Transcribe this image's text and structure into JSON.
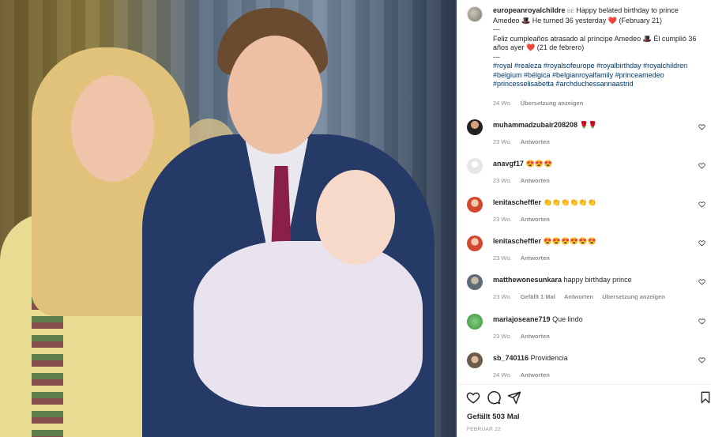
{
  "post": {
    "author": "europeanroyalchildre",
    "author_tag": "BE",
    "caption_line1": "Happy belated birthday to prince Amedeo 🎩 He turned 36 yesterday ❤️ (February 21)",
    "caption_sep1": "---",
    "caption_line2": "Feliz cumpleaños atrasado al príncipe Amedeo 🎩 Él cumplió 36 años ayer ❤️ (21 de febrero)",
    "caption_sep2": "---",
    "hashtags": "#royal #realeza #royalsofeurope #royalbirthday #royalchildren #belgium #bélgica #belgianroyalfamily #princeamedeo #princesselisabetta #archduchessannaastrid",
    "time": "24 Wo.",
    "translate": "Übersetzung anzeigen"
  },
  "comments": [
    {
      "user": "muhammadzubair208208",
      "text": "🌹🌹",
      "time": "23 Wo.",
      "reply": "Antworten"
    },
    {
      "user": "anavgf17",
      "text": "😍😍😍",
      "time": "23 Wo.",
      "reply": "Antworten"
    },
    {
      "user": "lenitascheffler",
      "text": "👏👏👏👏👏👏",
      "time": "23 Wo.",
      "reply": "Antworten"
    },
    {
      "user": "lenitascheffler",
      "text": "😍😍😍😍😍😍",
      "time": "23 Wo.",
      "reply": "Antworten"
    },
    {
      "user": "matthewonesunkara",
      "text": "happy birthday prince",
      "time": "23 Wo.",
      "likes": "Gefällt 1 Mal",
      "reply": "Antworten",
      "translate": "Übersetzung anzeigen"
    },
    {
      "user": "mariajoseane719",
      "text": "Que lindo",
      "time": "23 Wo.",
      "reply": "Antworten"
    },
    {
      "user": "sb_740116",
      "text": "Providencia",
      "time": "24 Wo.",
      "reply": "Antworten"
    }
  ],
  "footer": {
    "likes": "Gefällt 503 Mal",
    "date": "FEBRUAR 22"
  },
  "icons": {
    "like": "heart-icon",
    "comment": "comment-icon",
    "share": "send-icon",
    "save": "bookmark-icon"
  }
}
